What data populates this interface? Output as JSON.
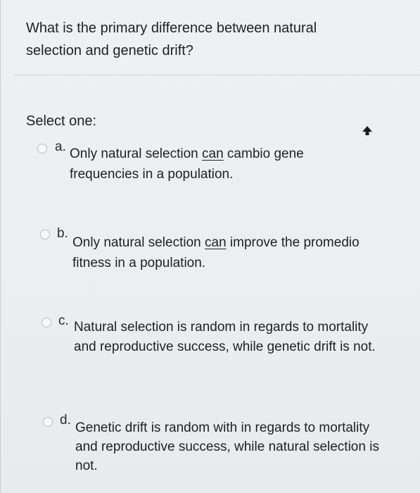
{
  "question": {
    "text": "What is the primary difference between natural selection and genetic drift?"
  },
  "select_label": "Select one:",
  "options": [
    {
      "letter": "a.",
      "before": "Only natural selection ",
      "underlined": "can",
      "after": " cambio gene frequencies in a population."
    },
    {
      "letter": "b.",
      "before": "Only natural selection ",
      "underlined": "can",
      "after": " improve the promedio fitness in a population."
    },
    {
      "letter": "c.",
      "text": "Natural selection is random in regards to mortality and reproductive success, while genetic drift is not."
    },
    {
      "letter": "d.",
      "text": "Genetic drift is random with in regards to mortality and reproductive success, while natural selection is not."
    }
  ]
}
